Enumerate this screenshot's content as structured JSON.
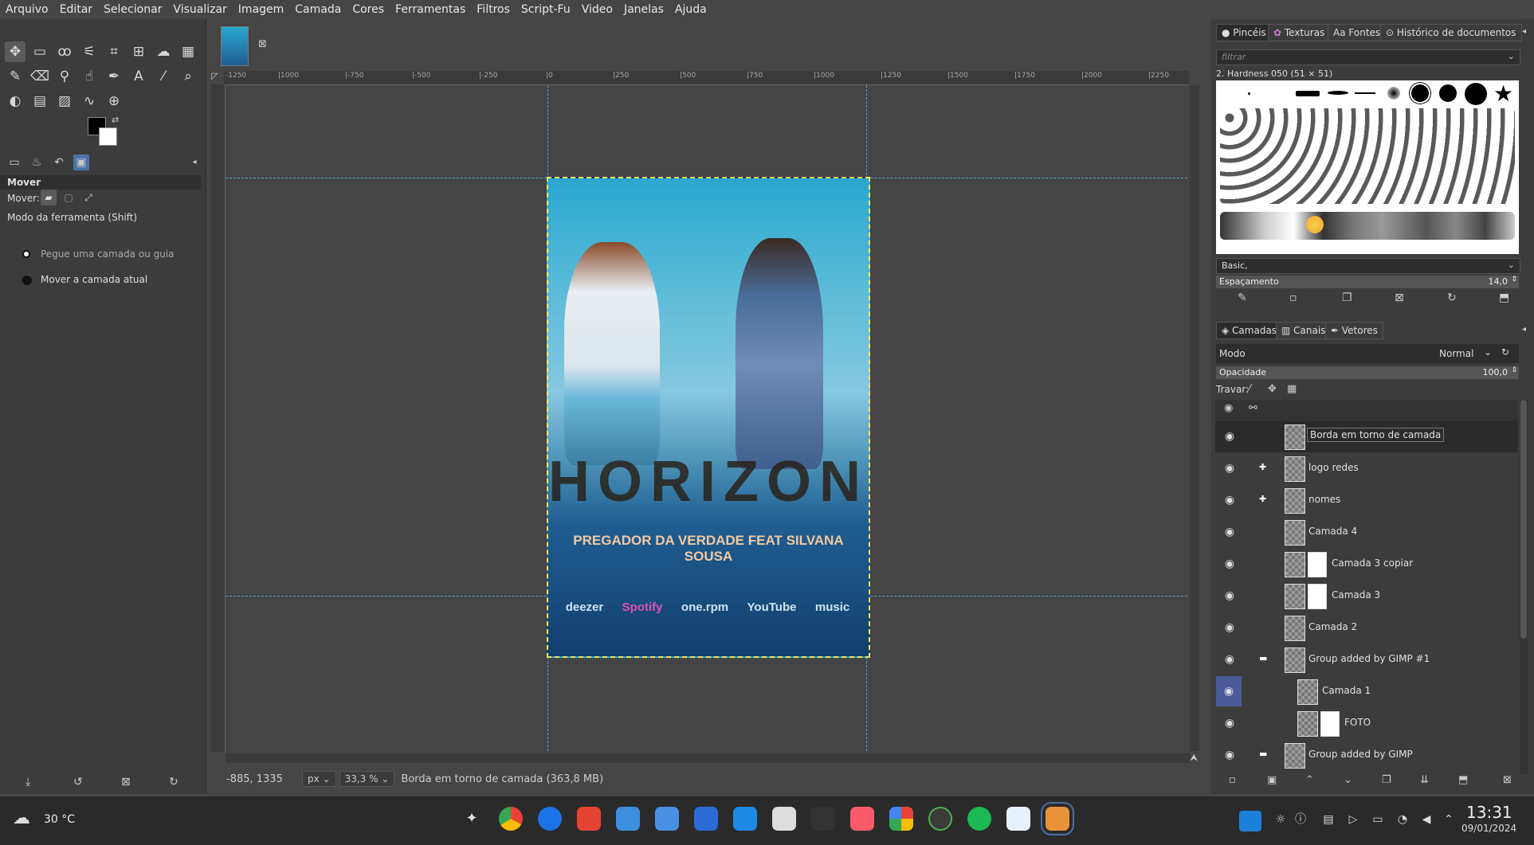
{
  "menubar": [
    "Arquivo",
    "Editar",
    "Selecionar",
    "Visualizar",
    "Imagem",
    "Camada",
    "Cores",
    "Ferramentas",
    "Filtros",
    "Script-Fu",
    "Video",
    "Janelas",
    "Ajuda"
  ],
  "tool_options": {
    "title": "Mover",
    "mover_label": "Mover:",
    "mode_label": "Modo da ferramenta (Shift)",
    "radio_1": "Pegue uma camada ou guia",
    "radio_2": "Mover a camada atual"
  },
  "ruler_ticks": [
    "-1250",
    "|1000",
    "|-750",
    "|-500",
    "|-250",
    "|0",
    "|250",
    "|500",
    "|750",
    "|1000",
    "|1250",
    "|1500",
    "|1750",
    "|2000",
    "|2250"
  ],
  "poster": {
    "title": "HORIZONTE",
    "subtitle": "PREGADOR DA VERDADE  FEAT SILVANA SOUSA",
    "logos": [
      "deezer",
      "Spotify",
      "one.rpm",
      "YouTube",
      "music"
    ]
  },
  "status": {
    "coords": "-885, 1335",
    "unit": "px",
    "zoom": "33,3 %",
    "message": "Borda em torno de camada (363,8 MB)"
  },
  "brushes_panel": {
    "tabs": [
      "Pincéis",
      "Texturas",
      "Fontes",
      "Histórico de documentos"
    ],
    "filter_placeholder": "filtrar",
    "brush_name": "2. Hardness 050 (51 × 51)",
    "tag": "Basic,",
    "spacing_label": "Espaçamento",
    "spacing_value": "14,0"
  },
  "layers_panel": {
    "tabs": [
      "Camadas",
      "Canais",
      "Vetores"
    ],
    "mode_label": "Modo",
    "mode_value": "Normal",
    "opacity_label": "Opacidade",
    "opacity_value": "100,0",
    "lock_label": "Travar:",
    "layers": [
      {
        "name": "Borda em torno de camada"
      },
      {
        "name": "logo redes"
      },
      {
        "name": "nomes"
      },
      {
        "name": "Camada 4"
      },
      {
        "name": "Camada 3 copiar"
      },
      {
        "name": "Camada 3"
      },
      {
        "name": "Camada 2"
      },
      {
        "name": "Group added by GIMP #1"
      },
      {
        "name": "Camada 1"
      },
      {
        "name": "FOTO"
      },
      {
        "name": "Group added by GIMP"
      }
    ]
  },
  "taskbar": {
    "weather": "30 °C",
    "time": "13:31",
    "date": "09/01/2024"
  }
}
